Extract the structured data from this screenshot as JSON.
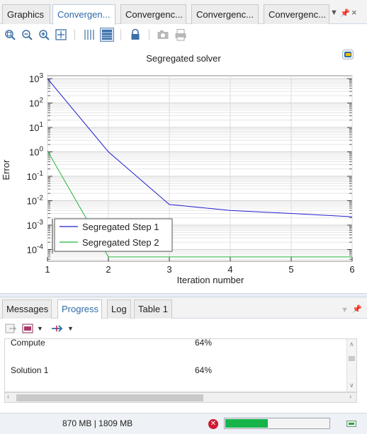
{
  "graphics_tabs": [
    {
      "label": "Graphics",
      "active": false
    },
    {
      "label": "Convergen...",
      "active": true
    },
    {
      "label": "Convergenc...",
      "active": false
    },
    {
      "label": "Convergenc...",
      "active": false
    },
    {
      "label": "Convergenc...",
      "active": false
    }
  ],
  "graphics_tab_controls": [
    "chevron-down-icon",
    "pin-icon",
    "close-icon"
  ],
  "toolbar_icons": [
    "zoom-box-icon",
    "zoom-out-icon",
    "zoom-in-icon",
    "zoom-extents-icon",
    "grid-icon",
    "table-view-icon",
    "lock-icon",
    "camera-icon",
    "print-icon"
  ],
  "plot": {
    "title": "Segregated solver"
  },
  "chart_data": {
    "type": "line",
    "title": "Segregated solver",
    "xlabel": "Iteration number",
    "ylabel": "Error",
    "yscale": "log",
    "xlim": [
      1,
      6
    ],
    "ylim": [
      5e-05,
      1000
    ],
    "xticks": [
      1,
      2,
      3,
      4,
      5,
      6
    ],
    "yticks": [
      "10^3",
      "10^2",
      "10^1",
      "10^0",
      "10^-1",
      "10^-2",
      "10^-3",
      "10^-4"
    ],
    "grid": true,
    "legend": "lower-left",
    "series": [
      {
        "name": "Segregated Step 1",
        "color": "#1f1fd0",
        "x": [
          1,
          2,
          3,
          4,
          5,
          6
        ],
        "y": [
          1000,
          1.0,
          0.007,
          0.004,
          0.003,
          0.0022
        ]
      },
      {
        "name": "Segregated Step 2",
        "color": "#22b43c",
        "x": [
          1,
          2,
          3,
          4,
          5,
          6
        ],
        "y": [
          1.1,
          5e-05,
          5e-05,
          5e-05,
          5e-05,
          5e-05
        ]
      }
    ]
  },
  "bottom_tabs": [
    {
      "label": "Messages",
      "active": false
    },
    {
      "label": "Progress",
      "active": true
    },
    {
      "label": "Log",
      "active": false
    },
    {
      "label": "Table 1",
      "active": false
    }
  ],
  "progress_rows": [
    {
      "name": "Compute",
      "value": "64%"
    },
    {
      "name": "Solution 1",
      "value": "64%"
    }
  ],
  "status": {
    "memory": "870 MB | 1809 MB",
    "progress_fraction": 0.64,
    "progress_color": "#16b44b"
  }
}
